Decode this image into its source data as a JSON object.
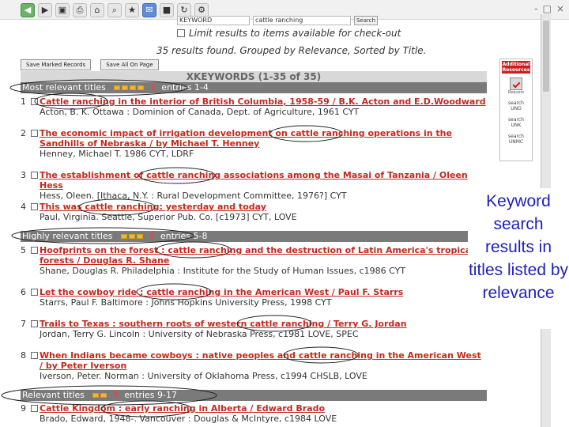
{
  "toolbar": {
    "icons": [
      "back-icon",
      "forward-icon",
      "page-icon",
      "print-icon",
      "home-icon",
      "search-icon",
      "history-icon",
      "mail-icon",
      "stop-icon",
      "refresh-icon",
      "tools-icon"
    ],
    "window_controls": [
      "-",
      "□",
      "×"
    ]
  },
  "search": {
    "field": "KEYWORD",
    "value": "cattle ranching",
    "button": "Search",
    "limit_label": "Limit results to items available for check-out"
  },
  "summary": {
    "text": "35 results found. Grouped by Relevance, Sorted by Title."
  },
  "actions": {
    "save_marked": "Save Marked Records",
    "save_all": "Save All On Page"
  },
  "results_header": "XKEYWORDS (1-35 of 35)",
  "groups": [
    {
      "label": "Most relevant titles",
      "entries": "entries 1-4"
    },
    {
      "label": "Highly relevant titles",
      "entries": "entries 5-8"
    },
    {
      "label": "Relevant titles",
      "entries": "entries 9-17"
    }
  ],
  "results": [
    {
      "num": "1",
      "title": "Cattle ranching in the interior of British Columbia, 1958-59 / B.K. Acton and E.D.Woodward",
      "meta": "Acton, B. K.   Ottawa : Dominion of Canada, Dept. of Agriculture, 1961   CYT"
    },
    {
      "num": "2",
      "title": "The economic impact of irrigation development on cattle ranching operations in the Sandhills of Nebraska / by Michael T. Henney",
      "meta": "Henney, Michael T.   1986   CYT, LDRF"
    },
    {
      "num": "3",
      "title": "The establishment of cattle ranching associations among the Masai of Tanzania / Oleen Hess",
      "meta": "Hess, Oleen.  [Ithaca, N.Y. : Rural Development Committee, 1976?]   CYT"
    },
    {
      "num": "4",
      "title": "This was cattle ranching: yesterday and today",
      "meta": "Paul, Virginia.   Seattle, Superior Pub. Co. [c1973]   CYT, LOVE"
    },
    {
      "num": "5",
      "title": "Hoofprints on the forest : cattle ranching and the destruction of Latin America's tropical forests / Douglas R. Shane",
      "meta": "Shane, Douglas R.   Philadelphia : Institute for the Study of Human Issues, c1986   CYT"
    },
    {
      "num": "6",
      "title": "Let the cowboy ride : cattle ranching in the American West / Paul F. Starrs",
      "meta": "Starrs, Paul F.   Baltimore : Johns Hopkins University Press, 1998   CYT"
    },
    {
      "num": "7",
      "title": "Trails to Texas : southern roots of western cattle ranching / Terry G. Jordan",
      "meta": "Jordan, Terry G.   Lincoln : University of Nebraska Press, c1981   LOVE, SPEC"
    },
    {
      "num": "8",
      "title": "When Indians became cowboys : native peoples and cattle ranching in the American West / by Peter Iverson",
      "meta": "Iverson, Peter.   Norman : University of Oklahoma Press, c1994   CHSLB, LOVE"
    },
    {
      "num": "9",
      "title": "Cattle Kingdom : early ranching in Alberta / Edward Brado",
      "meta": "Brado, Edward, 1948-.   Vancouver : Douglas & McIntyre, c1984   LOVE"
    }
  ],
  "right_panel": {
    "additional": "Additional Resources",
    "request_icon": "Request",
    "links": [
      {
        "label": "search",
        "name": "UNO"
      },
      {
        "label": "search",
        "name": "UNK"
      },
      {
        "label": "search",
        "name": "UNMC"
      }
    ]
  },
  "callout": {
    "text": "Keyword search results in titles listed by relevance"
  }
}
